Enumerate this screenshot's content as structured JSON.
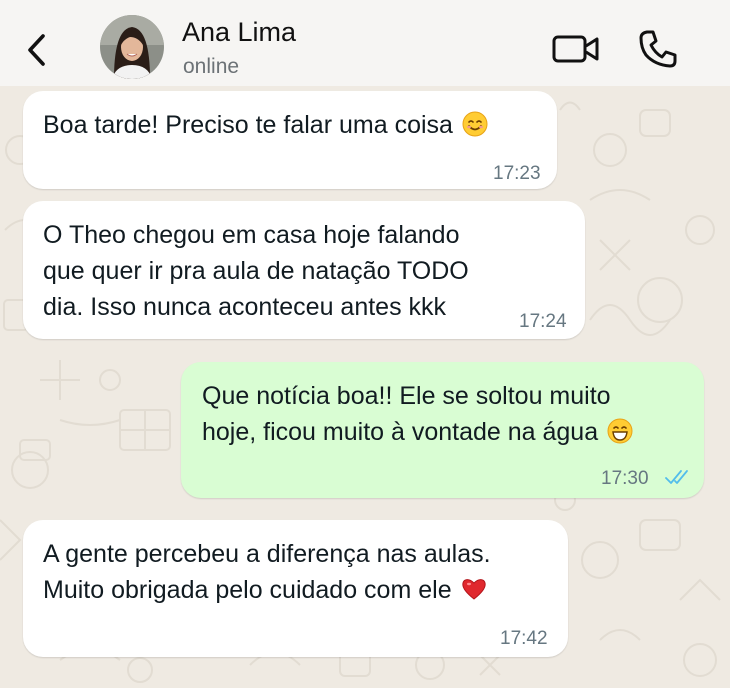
{
  "header": {
    "contact_name": "Ana Lima",
    "contact_status": "online",
    "back_icon": "chevron-left-icon",
    "video_icon": "video-camera-icon",
    "call_icon": "phone-icon"
  },
  "messages": [
    {
      "direction": "incoming",
      "text": "Boa tarde! Preciso te falar uma coisa",
      "emoji": "smiling-face-emoji",
      "time": "17:23"
    },
    {
      "direction": "incoming",
      "text": "O Theo chegou em casa hoje falando\nque quer ir pra aula de natação TODO\ndia. Isso nunca aconteceu antes kkk",
      "time": "17:24"
    },
    {
      "direction": "outgoing",
      "text": "Que notícia boa!! Ele se soltou muito\nhoje, ficou muito à vontade na água",
      "emoji": "grinning-face-emoji",
      "time": "17:30",
      "status": "read-double-check"
    },
    {
      "direction": "incoming",
      "text": "A gente percebeu a diferença nas aulas.\nMuito obrigada pelo cuidado com ele",
      "emoji": "red-heart-emoji",
      "time": "17:42"
    }
  ],
  "colors": {
    "chat_background": "#efeae2",
    "header_background": "#f6f5f3",
    "incoming_bubble": "#ffffff",
    "outgoing_bubble": "#d9fdd3",
    "read_ticks": "#53bdeb",
    "timestamp": "#667781"
  }
}
